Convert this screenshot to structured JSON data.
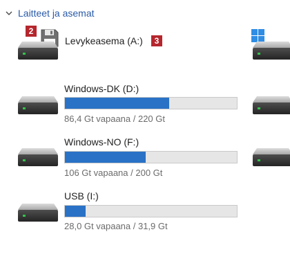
{
  "section": {
    "title": "Laitteet ja asemat",
    "chevron_icon": "chevron-down-icon"
  },
  "callouts": [
    "2",
    "3"
  ],
  "colors": {
    "accent_text": "#2a5aa8",
    "bar_fill": "#2a72c6",
    "bar_track": "#e6e6e6",
    "callout_bg": "#b5262d"
  },
  "drives": [
    {
      "name": "Levykeasema (A:)",
      "icon": "floppy-disk-icon"
    },
    {
      "name": "Windows-DK (D:)",
      "icon": "hard-drive-icon",
      "free_text": "86,4 Gt vapaana / 220 Gt",
      "used_fraction": 0.607
    },
    {
      "name": "Windows-NO (F:)",
      "icon": "hard-drive-icon",
      "free_text": "106 Gt vapaana / 200 Gt",
      "used_fraction": 0.47
    },
    {
      "name": "USB (I:)",
      "icon": "hard-drive-icon",
      "free_text": "28,0 Gt vapaana / 31,9 Gt",
      "used_fraction": 0.122
    }
  ],
  "right_column_icons": [
    "windows-logo-icon",
    "hard-drive-icon",
    "hard-drive-icon",
    "hard-drive-icon"
  ]
}
